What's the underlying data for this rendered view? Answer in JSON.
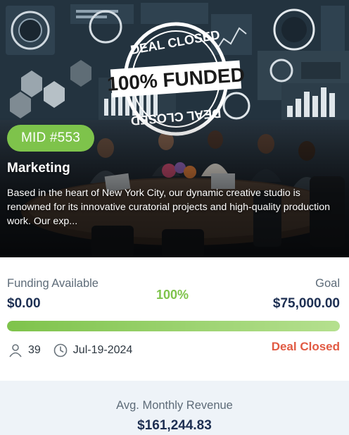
{
  "card": {
    "badge": "MID #553",
    "title": "Marketing",
    "description": "Based in the heart of New York City, our dynamic creative studio is renowned for its innovative curatorial projects and high-quality production work. Our exp...",
    "stamp": {
      "top_text": "DEAL CLOSED",
      "main_text": "100% FUNDED",
      "bottom_text": "DEAL CLOSED"
    }
  },
  "funding": {
    "available_label": "Funding Available",
    "available_value": "$0.00",
    "percent_label": "100%",
    "progress_fraction": 1.0,
    "goal_label": "Goal",
    "goal_value": "$75,000.00"
  },
  "meta": {
    "investors": "39",
    "date": "Jul-19-2024",
    "status": "Deal Closed"
  },
  "revenue": {
    "label": "Avg. Monthly Revenue",
    "value": "$161,244.83"
  },
  "colors": {
    "accent_green": "#7ec34b",
    "navy": "#1d2f52",
    "status_red": "#e15a43",
    "revenue_bg": "#eef3f8"
  }
}
